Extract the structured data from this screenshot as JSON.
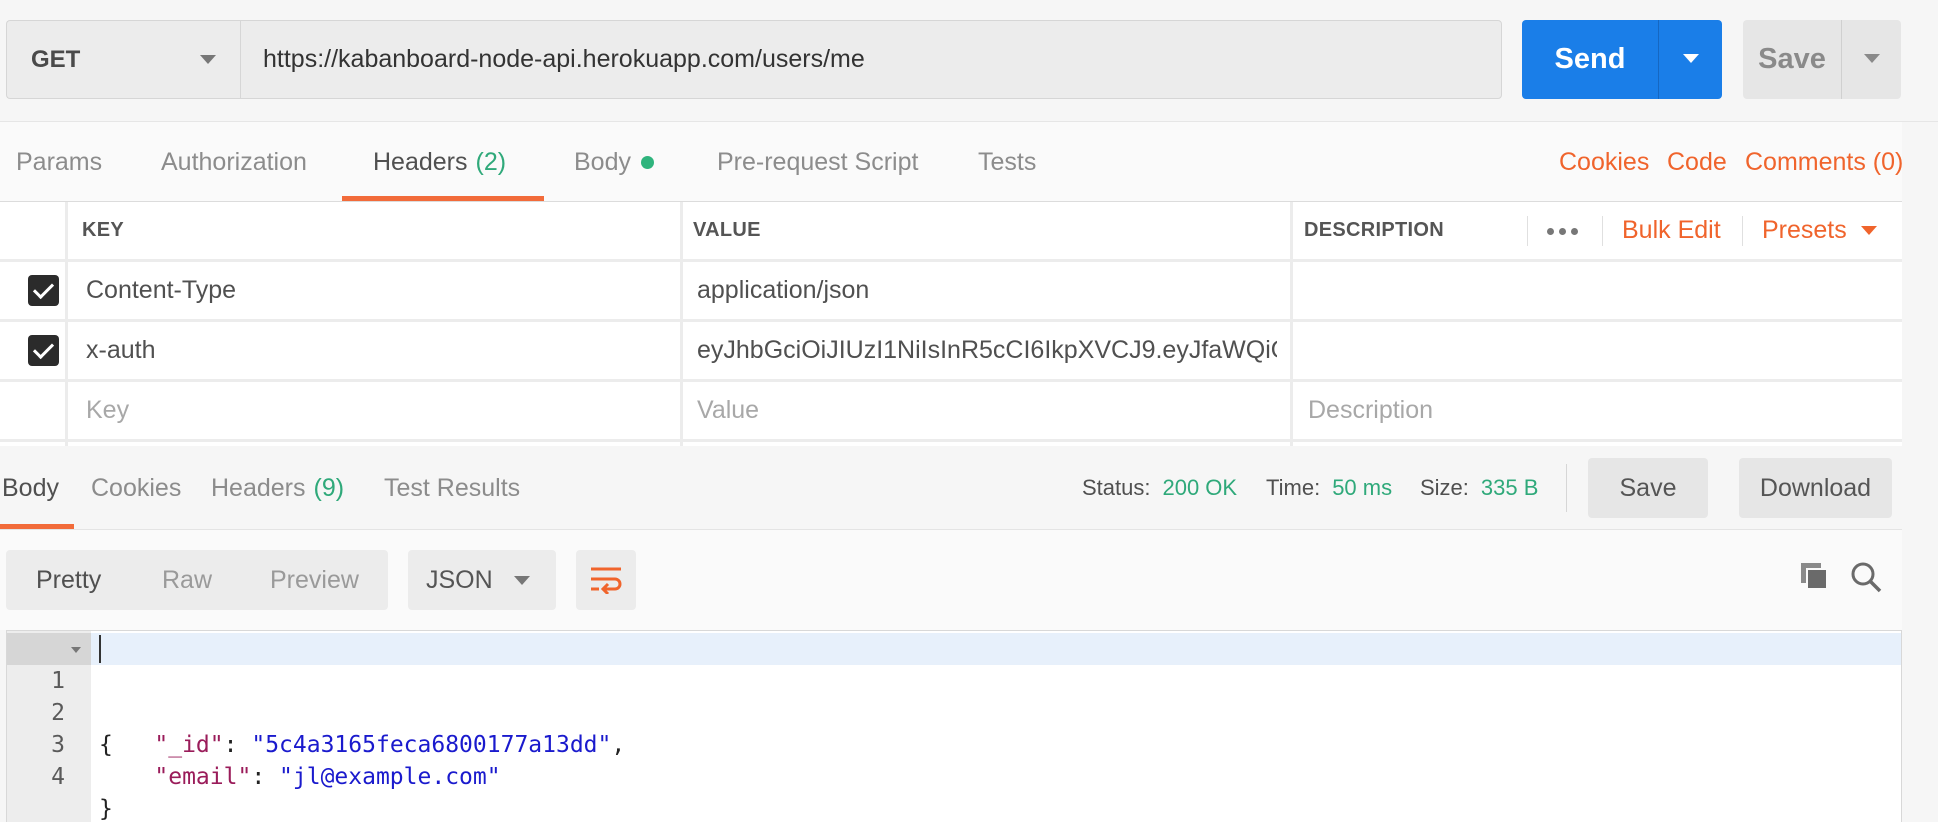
{
  "request": {
    "method": "GET",
    "url": "https://kabanboard-node-api.herokuapp.com/users/me",
    "send_label": "Send",
    "save_label": "Save"
  },
  "request_tabs": {
    "params": "Params",
    "authorization": "Authorization",
    "headers": "Headers",
    "headers_count": "(2)",
    "body": "Body",
    "prerequest": "Pre-request Script",
    "tests": "Tests",
    "cookies": "Cookies",
    "code": "Code",
    "comments": "Comments (0)"
  },
  "headers_table": {
    "col_key": "KEY",
    "col_value": "VALUE",
    "col_description": "DESCRIPTION",
    "bulk_edit": "Bulk Edit",
    "presets": "Presets",
    "rows": [
      {
        "checked": true,
        "key": "Content-Type",
        "value": "application/json",
        "description": ""
      },
      {
        "checked": true,
        "key": "x-auth",
        "value": "eyJhbGciOiJIUzI1NiIsInR5cCI6IkpXVCJ9.eyJfaWQiOiI...",
        "description": ""
      }
    ],
    "placeholder_key": "Key",
    "placeholder_value": "Value",
    "placeholder_description": "Description"
  },
  "response_tabs": {
    "body": "Body",
    "cookies": "Cookies",
    "headers": "Headers",
    "headers_count": "(9)",
    "test_results": "Test Results"
  },
  "response_status": {
    "status_label": "Status:",
    "status_value": "200 OK",
    "time_label": "Time:",
    "time_value": "50 ms",
    "size_label": "Size:",
    "size_value": "335 B",
    "save_label": "Save",
    "download_label": "Download"
  },
  "format_bar": {
    "pretty": "Pretty",
    "raw": "Raw",
    "preview": "Preview",
    "language": "JSON"
  },
  "editor": {
    "lines": [
      {
        "num": "1",
        "open": "{"
      },
      {
        "num": "2",
        "key": "\"_id\"",
        "sep": ": ",
        "value": "\"5c4a3165feca6800177a13dd\"",
        "tail": ","
      },
      {
        "num": "3",
        "key": "\"email\"",
        "sep": ": ",
        "value": "\"jl@example.com\"",
        "tail": ""
      },
      {
        "num": "4",
        "close": "}"
      }
    ]
  },
  "colors": {
    "accent": "#f26b3a",
    "primary": "#1a7ee8",
    "success": "#2fa97a"
  }
}
